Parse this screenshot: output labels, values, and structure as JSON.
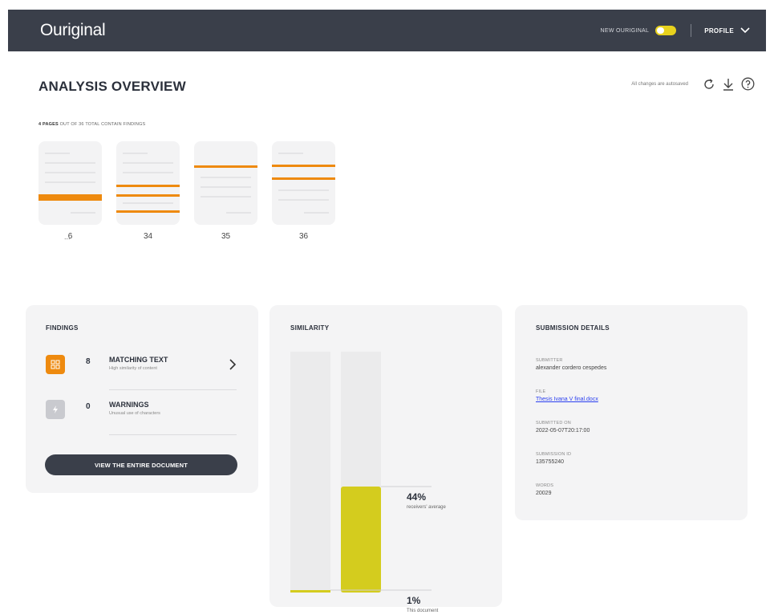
{
  "topbar": {
    "logo": "Ouriginal",
    "toggle_label": "NEW OURIGINAL",
    "profile_label": "PROFILE",
    "accent_color": "#e8d21d",
    "icons": [
      "toggle-switch",
      "chevron-down-icon"
    ]
  },
  "header": {
    "title": "ANALYSIS OVERVIEW",
    "autosave_text": "All changes are autosaved",
    "tools": [
      "refresh-icon",
      "download-icon",
      "help-icon"
    ]
  },
  "pages_summary": {
    "count": "4 PAGES",
    "rest": " OUT OF 36 TOTAL CONTAIN FINDINGS"
  },
  "thumbnails": {
    "pages": [
      "6",
      "34",
      "35",
      "36"
    ],
    "ellipsis": "...",
    "highlight_color": "#ee8a0f"
  },
  "findings": {
    "title": "FINDINGS",
    "items": [
      {
        "count": "8",
        "label": "MATCHING TEXT",
        "sub": "High similarity of content",
        "icon": "matching-text-icon",
        "color": "#ee8a0f"
      },
      {
        "count": "0",
        "label": "WARNINGS",
        "sub": "Unusual use of characters",
        "icon": "warning-icon",
        "color": "#c9cacf"
      }
    ],
    "button_label": "VIEW THE ENTIRE DOCUMENT"
  },
  "similarity": {
    "title": "SIMILARITY",
    "bars": [
      {
        "label": "This document",
        "value": 1,
        "display": "1%"
      },
      {
        "label": "receivers' average",
        "value": 44,
        "display": "44%"
      }
    ],
    "bar_color": "#d4cc1e"
  },
  "details": {
    "title": "SUBMISSION DETAILS",
    "rows": [
      {
        "label": "SUBMITTER",
        "value": "alexander cordero cespedes"
      },
      {
        "label": "FILE",
        "value": "Thesis Ivana V final.docx",
        "link": true
      },
      {
        "label": "SUBMITTED ON",
        "value": "2022-05-07T20:17:00"
      },
      {
        "label": "SUBMISSION ID",
        "value": "135755240"
      },
      {
        "label": "WORDS",
        "value": "20029"
      }
    ]
  }
}
